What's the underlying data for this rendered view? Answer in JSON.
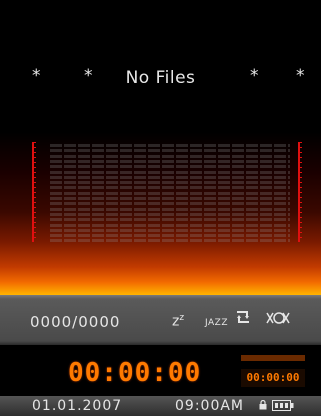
{
  "header": {
    "title": "No Files",
    "stars": [
      "*",
      "*",
      "*",
      "*"
    ]
  },
  "controls": {
    "counter": "0000/0000",
    "sleep_icon": "zz-sleep-icon",
    "eq_label": "JAZZ",
    "repeat_icon": "repeat-icon",
    "shuffle_icon": "shuffle-icon"
  },
  "playback": {
    "elapsed": "00:00:00",
    "total": "00:00:00"
  },
  "status": {
    "date": "01.01.2007",
    "time": "09:00AM",
    "lock_icon": "lock-icon",
    "battery_icon": "battery-icon"
  },
  "colors": {
    "accent": "#ff7a00",
    "meter": "#e01010"
  }
}
